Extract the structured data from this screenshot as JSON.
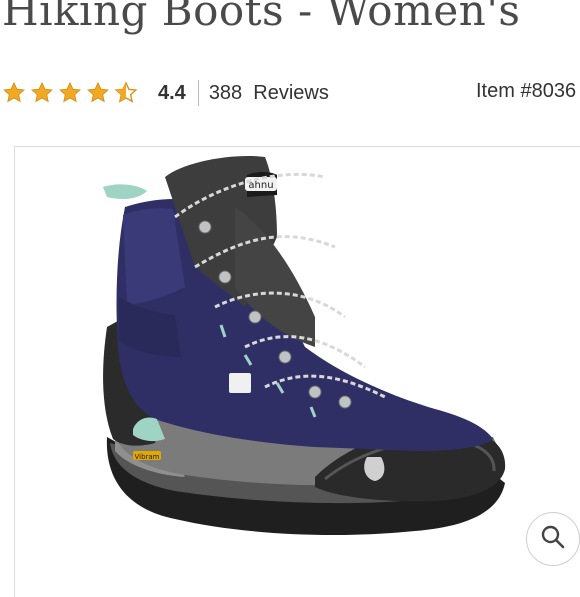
{
  "product": {
    "title": "Hiking Boots - Women's",
    "rating": 4.4,
    "rating_label": "4.4",
    "reviews_label": "388  Reviews",
    "item_number": "Item #8036"
  },
  "colors": {
    "star": "#f2a91f",
    "boot_upper": "#2f2f66",
    "boot_rubber": "#222222",
    "accent": "#9fd3c4"
  },
  "image": {
    "boot_brand_text": "ahnu",
    "sole_brand_text": "Vibram"
  },
  "icons": {
    "zoom": "magnifier-icon"
  }
}
